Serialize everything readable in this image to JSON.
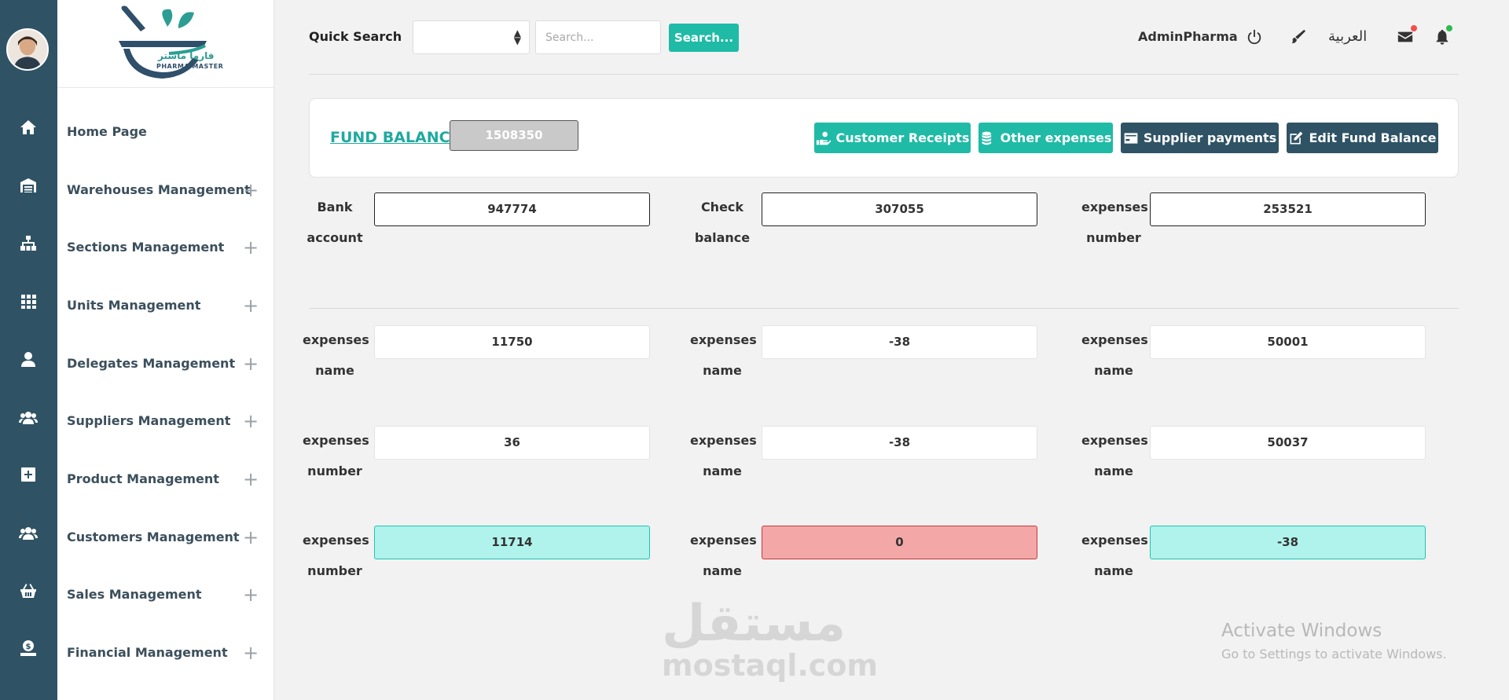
{
  "brand": {
    "name_ar": "فارما ماستر",
    "name_en": "PHARMA MASTER",
    "colors": {
      "teal": "#1fa9a0",
      "navy": "#2f4f6a"
    }
  },
  "rail": {
    "icons": [
      "home-icon",
      "warehouse-icon",
      "sitemap-icon",
      "grid-icon",
      "user-icon",
      "users-icon",
      "plus-square-icon",
      "users-icon",
      "basket-icon",
      "money-icon"
    ]
  },
  "sidebar": {
    "items": [
      {
        "label": "Home Page",
        "expandable": false
      },
      {
        "label": "Warehouses Management",
        "expandable": true
      },
      {
        "label": "Sections Management",
        "expandable": true
      },
      {
        "label": "Units Management",
        "expandable": true
      },
      {
        "label": "Delegates Management",
        "expandable": true
      },
      {
        "label": "Suppliers Management",
        "expandable": true
      },
      {
        "label": "Product Management",
        "expandable": true
      },
      {
        "label": "Customers Management",
        "expandable": true
      },
      {
        "label": "Sales Management",
        "expandable": true
      },
      {
        "label": "Financial Management",
        "expandable": true
      }
    ],
    "plus": "+"
  },
  "header": {
    "quick_search_label": "Quick Search",
    "search_placeholder": "Search...",
    "search_button": "Search...",
    "user": "AdminPharma",
    "language": "العربية",
    "accent": "#1fbba6"
  },
  "fund": {
    "title": "FUND BALANCE",
    "value": "1508350",
    "buttons": [
      {
        "label": "Customer Receipts",
        "icon": "hand-money-icon",
        "color": "#1fbba6"
      },
      {
        "label": "Other expenses",
        "icon": "coins-icon",
        "color": "#1fbba6"
      },
      {
        "label": "Supplier payments",
        "icon": "credit-card-icon",
        "color": "#2f5365"
      },
      {
        "label": "Edit Fund Balance",
        "icon": "edit-icon",
        "color": "#2f5365"
      }
    ]
  },
  "balances": [
    {
      "label_1": "Bank",
      "label_2": "account",
      "value": "947774"
    },
    {
      "label_1": "Check",
      "label_2": "balance",
      "value": "307055"
    },
    {
      "label_1": "expenses",
      "label_2": "number",
      "value": "253521"
    }
  ],
  "rows": [
    [
      {
        "label_1": "expenses",
        "label_2": "name",
        "value": "11750",
        "state": "light"
      },
      {
        "label_1": "expenses",
        "label_2": "name",
        "value": "-38",
        "state": "light"
      },
      {
        "label_1": "expenses",
        "label_2": "name",
        "value": "50001",
        "state": "light"
      }
    ],
    [
      {
        "label_1": "expenses",
        "label_2": "number",
        "value": "36",
        "state": "light"
      },
      {
        "label_1": "expenses",
        "label_2": "name",
        "value": "-38",
        "state": "light"
      },
      {
        "label_1": "expenses",
        "label_2": "name",
        "value": "50037",
        "state": "light"
      }
    ],
    [
      {
        "label_1": "expenses",
        "label_2": "number",
        "value": "11714",
        "state": "cyan"
      },
      {
        "label_1": "expenses",
        "label_2": "name",
        "value": "0",
        "state": "red"
      },
      {
        "label_1": "expenses",
        "label_2": "name",
        "value": "-38",
        "state": "cyan"
      }
    ]
  ],
  "watermark": {
    "ar": "مستقل",
    "en": "mostaql.com"
  },
  "windows_notice": {
    "line1": "Activate Windows",
    "line2": "Go to Settings to activate Windows."
  }
}
